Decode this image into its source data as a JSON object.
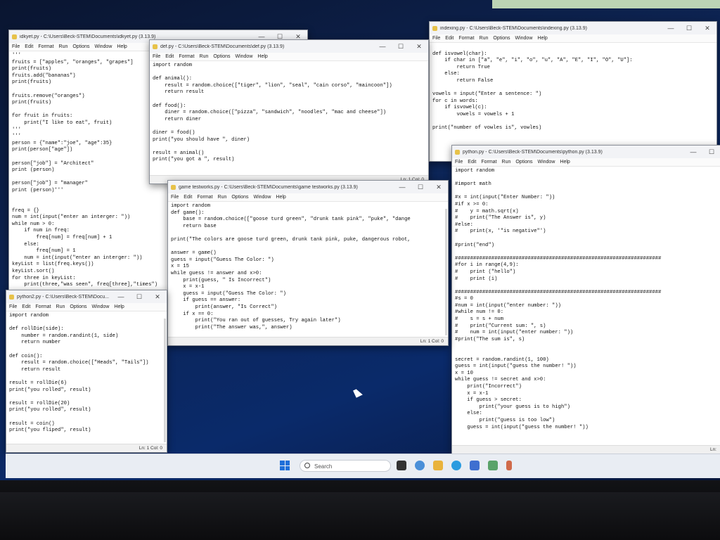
{
  "menu": [
    "File",
    "Edit",
    "Format",
    "Run",
    "Options",
    "Window",
    "Help"
  ],
  "windows": {
    "idkyet": {
      "title": "idkyet.py - C:\\Users\\Beck-STEM\\Documents\\idkyet.py (3.13.9)",
      "code": "'''\nfruits = [\"apples\", \"oranges\", \"grapes\"]\nprint(fruits)\nfruits.add(\"bananas\")\nprint(fruits)\n\nfruits.remove(\"oranges\")\nprint(fruits)\n\nfor fruit in fruits:\n    print(\"I like to eat\", fruit)\n'''\n'''\nperson = {\"name\":\"joe\", \"age\":35}\nprint(person[\"age\"])\n\nperson[\"job\"] = \"Architect\"\nprint (person)\n\nperson[\"job\"] = \"manager\"\nprint (person)'''\n\n\nfreq = {}\nnum = int(input(\"enter an interger: \"))\nwhile num > 0:\n    if num in freq:\n        freq[num] = freq[num] + 1\n    else:\n        freq[num] = 1\n    num = int(input(\"enter an interger: \"))\nkeyList = list(freq.keys())\nkeyList.sort()\nfor three in keyList:\n    print(three,\"was seen\", freq[three],\"times\")"
    },
    "def": {
      "title": "def.py - C:\\Users\\Beck-STEM\\Documents\\def.py (3.13.9)",
      "code": "import random\n\ndef animal():\n    result = random.choice([\"tiger\", \"lion\", \"seal\", \"cain corso\", \"maincoon\"])\n    return result\n\ndef food():\n    diner = random.choice([\"pizza\", \"sandwich\", \"noodles\", \"mac and cheese\"])\n    return diner\n\ndiner = food()\nprint(\"you should have \", diner)\n\nresult = animal()\nprint(\"you got a \", result)",
      "status": "Ln: 1   Col: 0"
    },
    "indexing": {
      "title": "indexing.py - C:\\Users\\Beck-STEM\\Documents\\indexing.py (3.13.9)",
      "code": "\ndef isvowel(char):\n    if char in [\"a\", \"e\", \"i\", \"o\", \"u\", \"A\", \"E\", \"I\", \"O\", \"U\"]:\n        return True\n    else:\n        return False\n\nvowels = input(\"Enter a sentence: \")\nfor c in words:\n    if isvowel(c):\n        vowels = vowels + 1\n\nprint(\"number of vowles is\", vowles)"
    },
    "game": {
      "title": "game testworks.py - C:\\Users\\Beck-STEM\\Documents\\game testworks.py (3.13.9)",
      "code": "import random\ndef game():\n    base = random.choice([\"goose turd green\", \"drunk tank pink\", \"puke\", \"dange\n    return base\n\nprint(\"The colors are goose turd green, drunk tank pink, puke, dangerous robot,\n\nanswer = game()\nguess = input(\"Guess The Color: \")\nx = 15\nwhile guess != answer and x>0:\n    print(guess, \" Is Incorrect\")\n    x = x-1\n    guess = input(\"Guess The Color: \")\n    if guess == answer:\n        print(answer, \"Is Correct\")\n    if x == 0:\n        print(\"You ran out of guesses, Try again later\")\n        print(\"The answer was,\", answer)",
      "status": "Ln: 1   Col: 0"
    },
    "python2": {
      "title": "python2.py - C:\\Users\\Beck-STEM\\Docu...",
      "code": "import random\n\ndef rollDie(side):\n    number = random.randint(1, side)\n    return number\n\ndef coin():\n    result = random.choice([\"Heads\", \"Tails\"])\n    return result\n\nresult = rollDie(6)\nprint(\"you rolled\", result)\n\nresult = rollDie(20)\nprint(\"you rolled\", result)\n\nresult = coin()\nprint(\"you fliped\", result)",
      "status": "Ln: 1   Col: 0"
    },
    "python": {
      "title": "python.py - C:\\Users\\Beck-STEM\\Documents\\python.py (3.13.9)",
      "code": "import random\n\n#import math\n\n#x = int(input(\"Enter Number: \"))\n#if x >= 0:\n#    y = math.sqrt(x)\n#    print(\"The Answer is\", y)\n#else:\n#    print(x, '\"is negative\"')\n\n#print(\"end\")\n\n####################################################################\n#for i in range(4,9):\n#    print (\"hello\")\n#    print (i)\n\n####################################################################\n#s = 0\n#num = int(input(\"enter number: \"))\n#while num != 0:\n#    s = s + num\n#    print(\"Current sum: \", s)\n#    num = int(input(\"enter number: \"))\n#print(\"The sum is\", s)\n\n\nsecret = random.randint(1, 100)\nguess = int(input(\"guess the number! \"))\nx = 10\nwhile guess != secret and x>0:\n    print(\"Incorrect\")\n    x = x-1\n    if guess > secret:\n        print(\"your guess is to high\")\n    else:\n        print(\"guess is too low\")\n    guess = int(input(\"guess the number! \"))",
      "status": "Ln:"
    }
  },
  "taskbar": {
    "search_placeholder": "Search"
  },
  "colors": {
    "taskbar": "#e9edf3",
    "start_blue": "#1e6fd9",
    "desktop": "#0d2454"
  }
}
